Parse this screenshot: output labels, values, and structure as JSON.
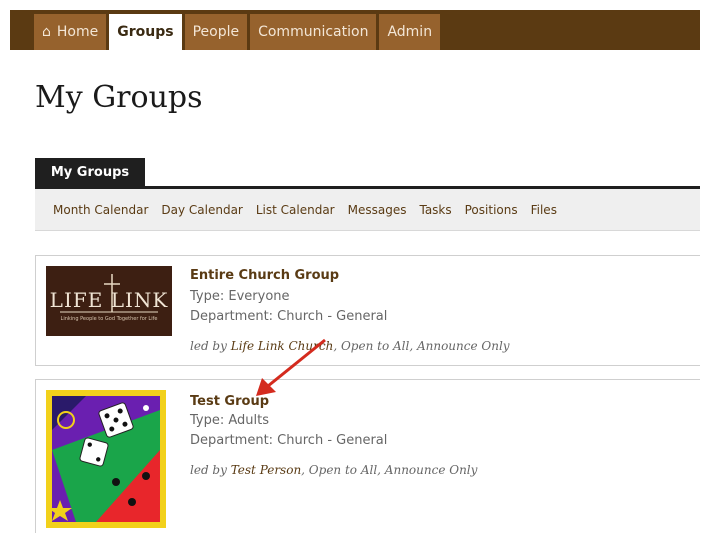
{
  "nav": {
    "tabs": [
      {
        "label": "Home",
        "icon": "home-icon",
        "active": false
      },
      {
        "label": "Groups",
        "active": true
      },
      {
        "label": "People",
        "active": false
      },
      {
        "label": "Communication",
        "active": false
      },
      {
        "label": "Admin",
        "active": false
      }
    ]
  },
  "page": {
    "title": "My Groups"
  },
  "subtab": {
    "label": "My Groups"
  },
  "subnav": {
    "links": [
      "Month Calendar",
      "Day Calendar",
      "List Calendar",
      "Messages",
      "Tasks",
      "Positions",
      "Files"
    ]
  },
  "groups": [
    {
      "name": "Entire Church Group",
      "type": "Type: Everyone",
      "department": "Department: Church - General",
      "led_prefix": "led by ",
      "leader": "Life Link Church",
      "led_suffix": ", Open to All, Announce Only",
      "logo_text": "LIFE LINK",
      "logo_subtext": "Linking People to God Together for Life"
    },
    {
      "name": "Test Group",
      "type": "Type: Adults",
      "department": "Department: Church - General",
      "led_prefix": "led by ",
      "leader": "Test Person",
      "led_suffix": ", Open to All, Announce Only"
    }
  ],
  "colors": {
    "nav_bg": "#5b3a12",
    "tab_bg": "#96622d",
    "link": "#5a3b14",
    "arrow": "#d42b1e"
  }
}
